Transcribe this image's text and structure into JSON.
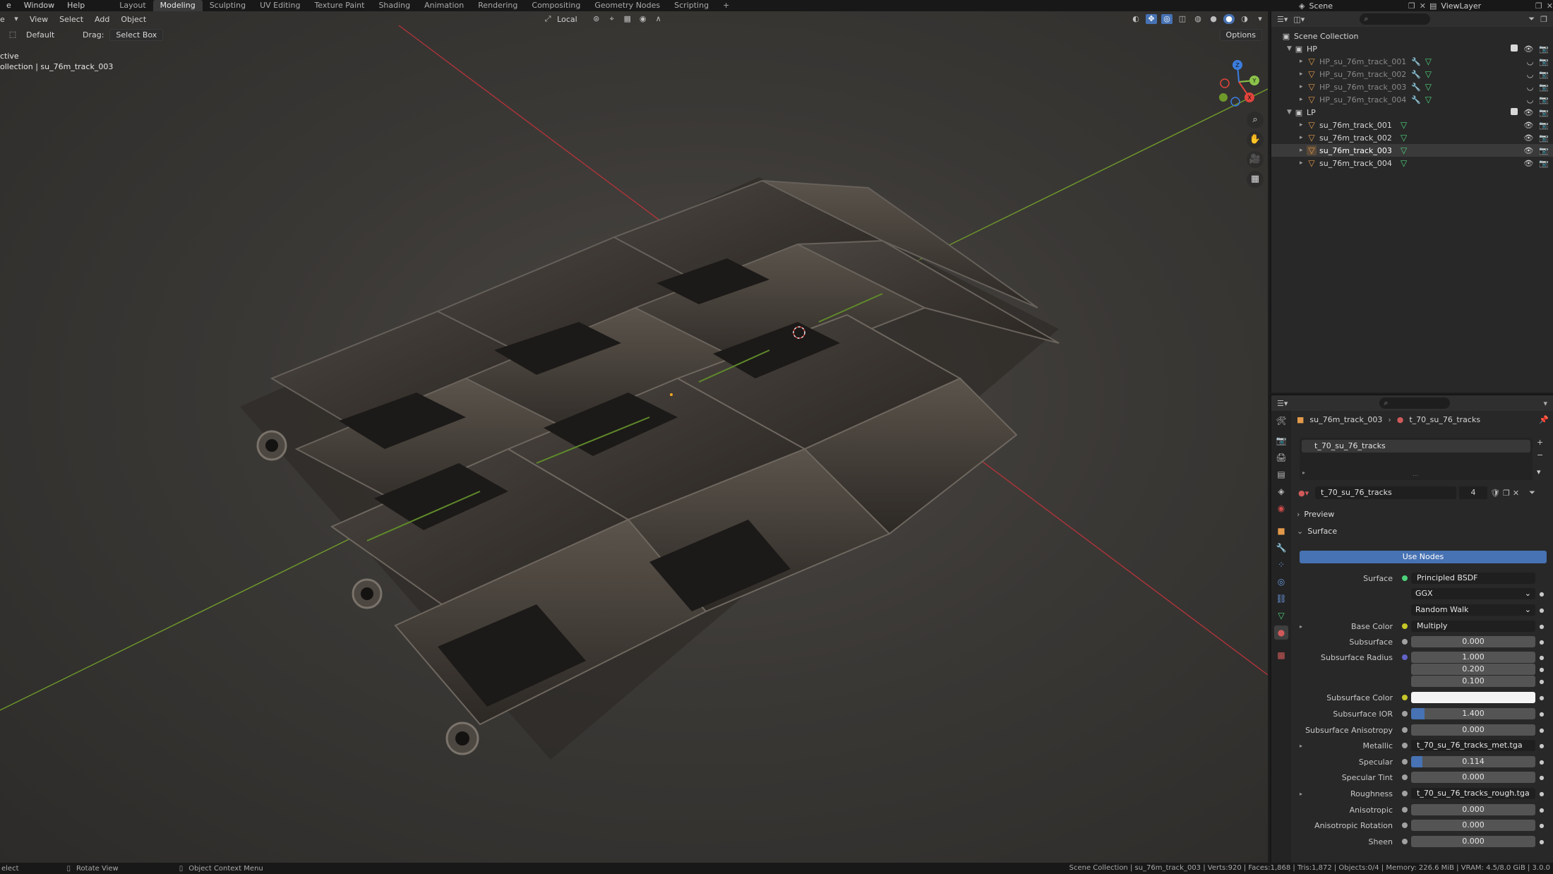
{
  "topbar": {
    "menus": [
      "e",
      "Window",
      "Help"
    ],
    "workspaces": [
      "Layout",
      "Modeling",
      "Sculpting",
      "UV Editing",
      "Texture Paint",
      "Shading",
      "Animation",
      "Rendering",
      "Compositing",
      "Geometry Nodes",
      "Scripting"
    ],
    "active_workspace": "Modeling",
    "add_tab": "+",
    "scene": "Scene",
    "view_layer": "ViewLayer"
  },
  "viewport": {
    "header_menus": [
      "e",
      "View",
      "Select",
      "Add",
      "Object"
    ],
    "orientation": "Local",
    "mode_label": "Default",
    "drag_label": "Drag:",
    "drag_value": "Select Box",
    "options_label": "Options",
    "info_line1": "ctive",
    "info_line2": "ollection | su_76m_track_003",
    "gizmo_axes": {
      "x": "X",
      "y": "Y",
      "z": "Z"
    }
  },
  "outliner": {
    "root": "Scene Collection",
    "collections": [
      {
        "name": "HP",
        "objects": [
          "HP_su_76m_track_001",
          "HP_su_76m_track_002",
          "HP_su_76m_track_003",
          "HP_su_76m_track_004"
        ]
      },
      {
        "name": "LP",
        "objects": [
          "su_76m_track_001",
          "su_76m_track_002",
          "su_76m_track_003",
          "su_76m_track_004"
        ]
      }
    ]
  },
  "properties": {
    "breadcrumb_object": "su_76m_track_003",
    "breadcrumb_material": "t_70_su_76_tracks",
    "slot_name": "t_70_su_76_tracks",
    "material_name": "t_70_su_76_tracks",
    "material_users": "4",
    "preview_label": "Preview",
    "surface_panel_label": "Surface",
    "use_nodes_label": "Use Nodes",
    "surface_label": "Surface",
    "surface_value": "Principled BSDF",
    "distribution": "GGX",
    "subsurface_method": "Random Walk",
    "rows": [
      {
        "label": "Base Color",
        "value": "Multiply",
        "kind": "link",
        "dot": "#c7c729",
        "expand": true
      },
      {
        "label": "Subsurface",
        "value": "0.000",
        "kind": "num",
        "dot": "#a1a1a1"
      },
      {
        "label": "Subsurface Radius",
        "value": "1.000",
        "kind": "num",
        "dot": "#6363c7"
      },
      {
        "label": "",
        "value": "0.200",
        "kind": "num"
      },
      {
        "label": "",
        "value": "0.100",
        "kind": "num"
      },
      {
        "label": "Subsurface Color",
        "value": "",
        "kind": "color",
        "dot": "#c7c729"
      },
      {
        "label": "Subsurface IOR",
        "value": "1.400",
        "kind": "num",
        "dot": "#a1a1a1",
        "fill": 0.11
      },
      {
        "label": "Subsurface Anisotropy",
        "value": "0.000",
        "kind": "num",
        "dot": "#a1a1a1"
      },
      {
        "label": "Metallic",
        "value": "t_70_su_76_tracks_met.tga",
        "kind": "link",
        "dot": "#a1a1a1",
        "expand": true
      },
      {
        "label": "Specular",
        "value": "0.114",
        "kind": "num",
        "dot": "#a1a1a1",
        "fill": 0.09
      },
      {
        "label": "Specular Tint",
        "value": "0.000",
        "kind": "num",
        "dot": "#a1a1a1"
      },
      {
        "label": "Roughness",
        "value": "t_70_su_76_tracks_rough.tga",
        "kind": "link",
        "dot": "#a1a1a1",
        "expand": true
      },
      {
        "label": "Anisotropic",
        "value": "0.000",
        "kind": "num",
        "dot": "#a1a1a1"
      },
      {
        "label": "Anisotropic Rotation",
        "value": "0.000",
        "kind": "num",
        "dot": "#a1a1a1"
      },
      {
        "label": "Sheen",
        "value": "0.000",
        "kind": "num",
        "dot": "#a1a1a1"
      }
    ]
  },
  "statusbar": {
    "left1": "elect",
    "left2": "Rotate View",
    "left3": "Object Context Menu",
    "right": "Scene Collection | su_76m_track_003 | Verts:920 | Faces:1,868 | Tris:1,872 | Objects:0/4 | Memory: 226.6 MiB | VRAM: 4.5/8.0 GiB | 3.0.0"
  }
}
